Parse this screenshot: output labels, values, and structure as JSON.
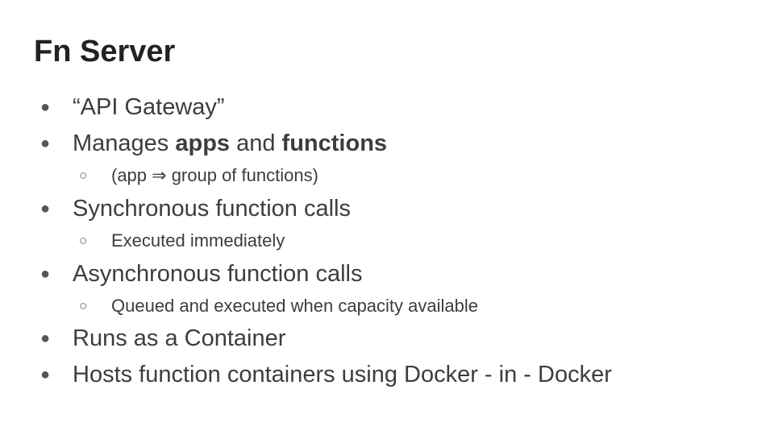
{
  "slide": {
    "title": "Fn Server",
    "bullet_glyph": "●",
    "sub_bullet_glyph": "○",
    "items": [
      {
        "text": "“API Gateway”"
      },
      {
        "pre": "Manages ",
        "bold1": "apps",
        "mid": " and ",
        "bold2": "functions"
      },
      {
        "text": "(app ⇒ group of functions)"
      },
      {
        "text": "Synchronous function calls"
      },
      {
        "text": "Executed immediately"
      },
      {
        "text": "Asynchronous function calls"
      },
      {
        "text": "Queued and executed when capacity available"
      },
      {
        "text": "Runs as a Container"
      },
      {
        "text": "Hosts function containers using Docker - in - Docker"
      }
    ]
  }
}
